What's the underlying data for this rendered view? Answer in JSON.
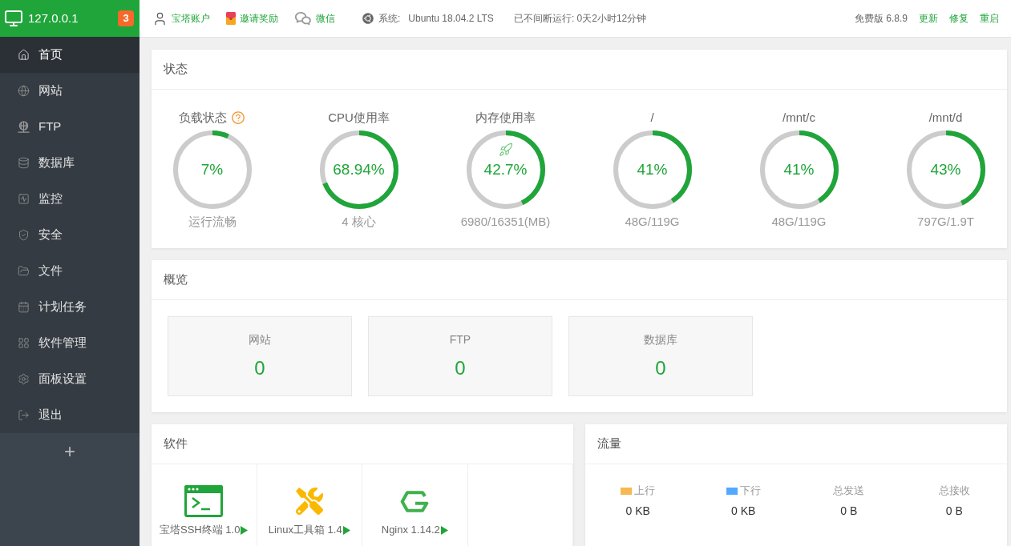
{
  "sidebar": {
    "host": "127.0.0.1",
    "badge": "3",
    "items": [
      {
        "label": "首页",
        "selected": true
      },
      {
        "label": "网站",
        "selected": false
      },
      {
        "label": "FTP",
        "selected": false
      },
      {
        "label": "数据库",
        "selected": false
      },
      {
        "label": "监控",
        "selected": false
      },
      {
        "label": "安全",
        "selected": false
      },
      {
        "label": "文件",
        "selected": false
      },
      {
        "label": "计划任务",
        "selected": false
      },
      {
        "label": "软件管理",
        "selected": false
      },
      {
        "label": "面板设置",
        "selected": false
      },
      {
        "label": "退出",
        "selected": false
      }
    ],
    "add_label": "+"
  },
  "topbar": {
    "links": [
      "宝塔账户",
      "邀请奖励",
      "微信"
    ],
    "system_label": "系统:",
    "system_value": "Ubuntu 18.04.2 LTS",
    "uptime": "已不间断运行: 0天2小时12分钟",
    "version": "免费版 6.8.9",
    "actions": [
      "更新",
      "修复",
      "重启"
    ]
  },
  "status": {
    "title": "状态",
    "gauges": [
      {
        "kind": "load",
        "title": "负载状态",
        "value": "7%",
        "level": 0.07,
        "caption": "运行流畅"
      },
      {
        "kind": "cpu",
        "title": "CPU使用率",
        "value": "68.94%",
        "level": 0.6894,
        "caption": "4 核心"
      },
      {
        "kind": "memory",
        "title": "内存使用率",
        "value": "42.7%",
        "level": 0.427,
        "caption": "6980/16351(MB)"
      },
      {
        "kind": "disk",
        "title": "/",
        "value": "41%",
        "level": 0.41,
        "caption": "48G/119G"
      },
      {
        "kind": "disk",
        "title": "/mnt/c",
        "value": "41%",
        "level": 0.41,
        "caption": "48G/119G"
      },
      {
        "kind": "disk",
        "title": "/mnt/d",
        "value": "43%",
        "level": 0.43,
        "caption": "797G/1.9T"
      }
    ]
  },
  "overview": {
    "title": "概览",
    "tiles": [
      {
        "label": "网站",
        "value": "0"
      },
      {
        "label": "FTP",
        "value": "0"
      },
      {
        "label": "数据库",
        "value": "0"
      }
    ]
  },
  "software": {
    "title": "软件",
    "items": [
      {
        "name": "宝塔SSH终端 1.0"
      },
      {
        "name": "Linux工具箱 1.4"
      },
      {
        "name": "Nginx 1.14.2"
      }
    ]
  },
  "traffic": {
    "title": "流量",
    "stats": [
      {
        "label": "上行",
        "color": "#f7b851",
        "value": "0 KB"
      },
      {
        "label": "下行",
        "color": "#52a9ff",
        "value": "0 KB"
      },
      {
        "label": "总发送",
        "value": "0 B"
      },
      {
        "label": "总接收",
        "value": "0 B"
      }
    ]
  }
}
